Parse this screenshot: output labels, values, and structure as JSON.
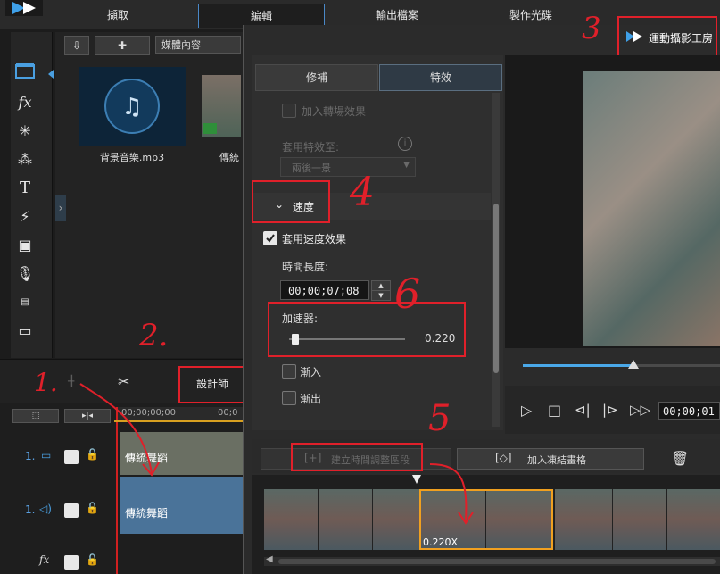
{
  "app": {
    "main_tabs": [
      "擷取",
      "編輯",
      "輸出檔案",
      "製作光碟"
    ],
    "active_tab": "編輯"
  },
  "library": {
    "dropdown": "媒體內容",
    "items": [
      {
        "name": "背景音樂.mp3"
      },
      {
        "name": "傳統"
      }
    ]
  },
  "timeline": {
    "designer_button": "設計師",
    "ruler_time": "00;00;00;00",
    "ruler_time2": "00;0",
    "tracks": [
      {
        "label": "1.",
        "type": "video",
        "clip": "傳統舞蹈"
      },
      {
        "label": "1.",
        "type": "audio",
        "clip": "傳統舞蹈"
      }
    ]
  },
  "dialog": {
    "title": "運動攝影工房",
    "tabs": [
      "修補",
      "特效"
    ],
    "active_tab": "特效",
    "add_transition_effect": "加入轉場效果",
    "apply_effect_to": "套用特效至:",
    "apply_effect_option": "兩後一景",
    "speed_section": "速度",
    "apply_speed_effect": "套用速度效果",
    "duration_label": "時間長度:",
    "duration_value": "00;00;07;08",
    "accelerator_label": "加速器:",
    "accelerator_value": "0.220",
    "accelerator_level": 0.02,
    "ease_in": "漸入",
    "ease_out": "漸出",
    "create_time_range": "建立時間調整區段",
    "add_freeze_frame": "加入凍結畫格",
    "playback_time": "00;00;01",
    "progress_fraction": 0.56,
    "clip_speed_badge": "0.220X"
  },
  "annotations": [
    "1.",
    "2.",
    "3",
    "4",
    "5",
    "6"
  ],
  "colors": {
    "accent_blue": "#4a88c7",
    "annotation_red": "#e0202a",
    "clip_selected": "#f0a020"
  }
}
